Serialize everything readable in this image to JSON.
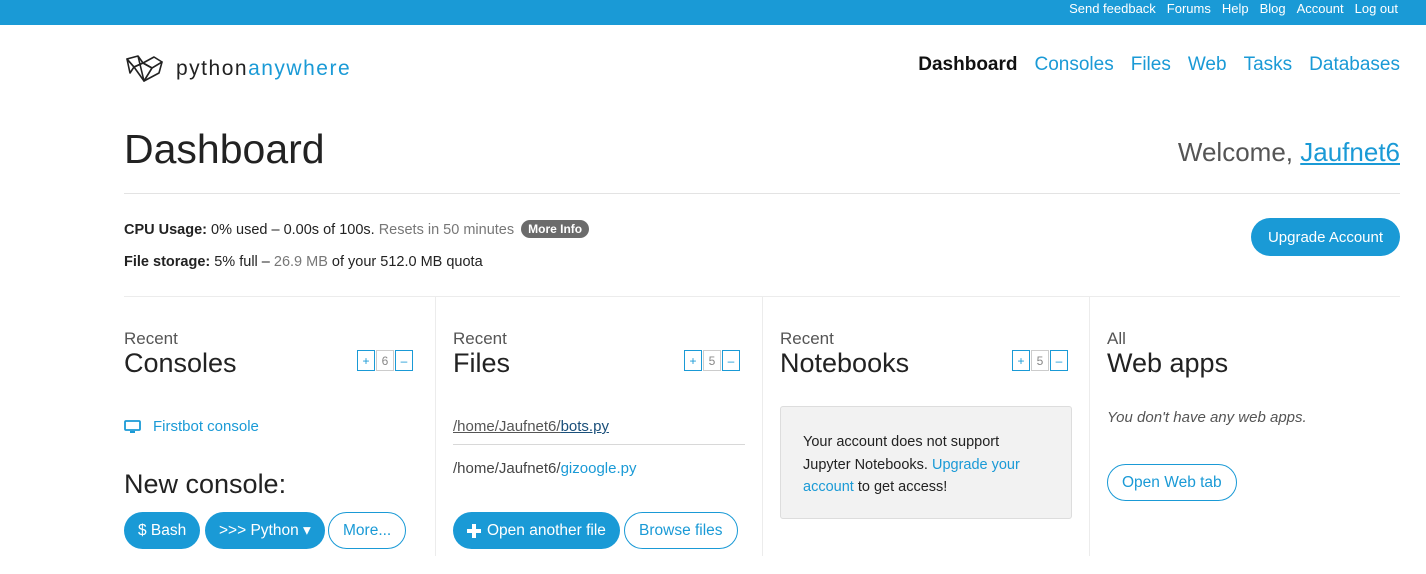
{
  "topbar": {
    "links": [
      "Send feedback",
      "Forums",
      "Help",
      "Blog",
      "Account",
      "Log out"
    ]
  },
  "logo": {
    "text_main": "python",
    "text_accent": "anywhere"
  },
  "nav": {
    "items": [
      {
        "label": "Dashboard",
        "active": true
      },
      {
        "label": "Consoles",
        "active": false
      },
      {
        "label": "Files",
        "active": false
      },
      {
        "label": "Web",
        "active": false
      },
      {
        "label": "Tasks",
        "active": false
      },
      {
        "label": "Databases",
        "active": false
      }
    ]
  },
  "page": {
    "title": "Dashboard",
    "welcome_prefix": "Welcome, ",
    "username": "Jaufnet6"
  },
  "usage": {
    "cpu_label": "CPU Usage:",
    "cpu_value": " 0% used – 0.00s of 100s.",
    "cpu_reset": " Resets in 50 minutes",
    "more_info": "More Info",
    "storage_label": "File storage:",
    "storage_value": " 5% full – ",
    "storage_used": "26.9 MB",
    "storage_quota": " of your 512.0 MB quota"
  },
  "upgrade_button": "Upgrade Account",
  "consoles": {
    "small": "Recent",
    "title": "Consoles",
    "counter": {
      "plus": "+",
      "value": "6",
      "minus": "–"
    },
    "items": [
      "Firstbot console"
    ],
    "new_console_label": "New console:",
    "bash_button": "$ Bash",
    "python_button": ">>> Python ▾",
    "more_button": "More..."
  },
  "files": {
    "small": "Recent",
    "title": "Files",
    "counter": {
      "plus": "+",
      "value": "5",
      "minus": "–"
    },
    "items": [
      {
        "path": "/home/Jaufnet6/",
        "name": "bots.py"
      },
      {
        "path": "/home/Jaufnet6/",
        "name": "gizoogle.py"
      }
    ],
    "open_button": "Open another file",
    "browse_button": "Browse files"
  },
  "notebooks": {
    "small": "Recent",
    "title": "Notebooks",
    "counter": {
      "plus": "+",
      "value": "5",
      "minus": "–"
    },
    "message_pre": "Your account does not support Jupyter Notebooks. ",
    "message_link": "Upgrade your account",
    "message_post": " to get access!"
  },
  "webapps": {
    "small": "All",
    "title": "Web apps",
    "empty": "You don't have any web apps.",
    "open_button": "Open Web tab"
  },
  "colors": {
    "accent": "#1a9ad6",
    "topbar": "#1a9ad6",
    "pill": "#6b6b6b"
  }
}
